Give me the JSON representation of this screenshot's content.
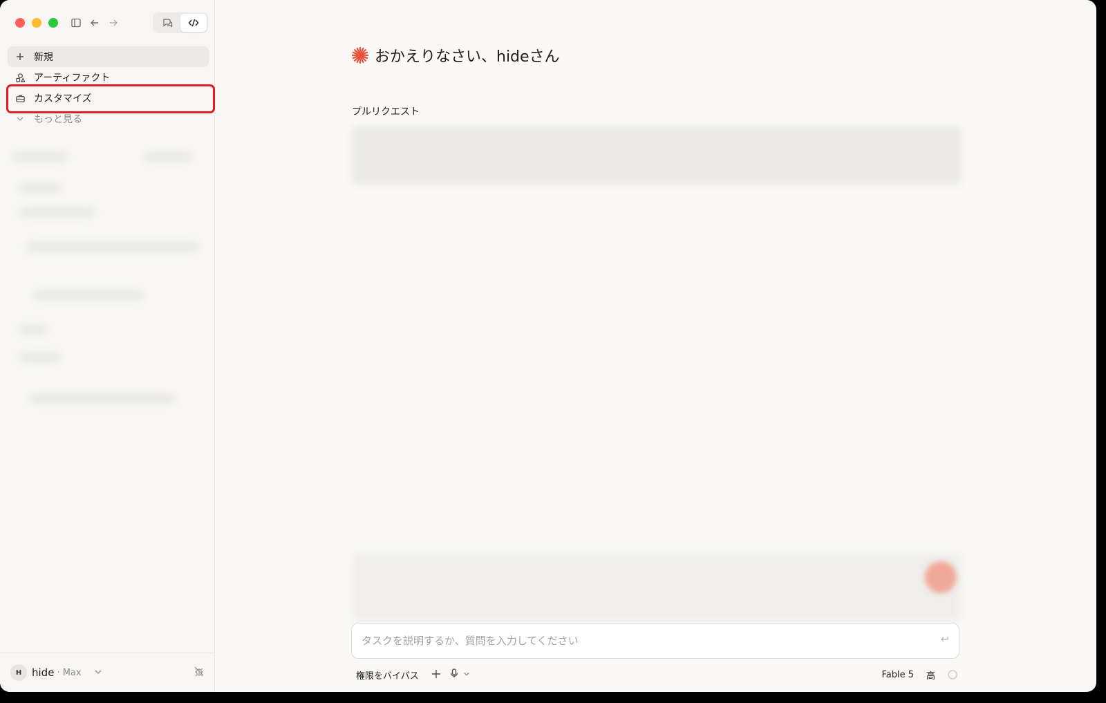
{
  "sidebar": {
    "nav": [
      {
        "label": "新規",
        "icon": "plus-icon"
      },
      {
        "label": "アーティファクト",
        "icon": "artifacts-icon"
      },
      {
        "label": "カスタマイズ",
        "icon": "briefcase-icon"
      },
      {
        "label": "もっと見る",
        "icon": "chevron-down-icon"
      }
    ],
    "user": {
      "initial": "H",
      "name": "hide",
      "plan": "· Max"
    }
  },
  "main": {
    "greeting": "おかえりなさい、hideさん",
    "section_title": "プルリクエスト",
    "input_placeholder": "タスクを説明するか、質問を入力してください",
    "toolbar": {
      "permission_label": "権限をバイパス",
      "model_label": "Fable 5",
      "effort_label": "高"
    }
  },
  "colors": {
    "accent": "#e8543d",
    "highlight": "#e01b24"
  }
}
